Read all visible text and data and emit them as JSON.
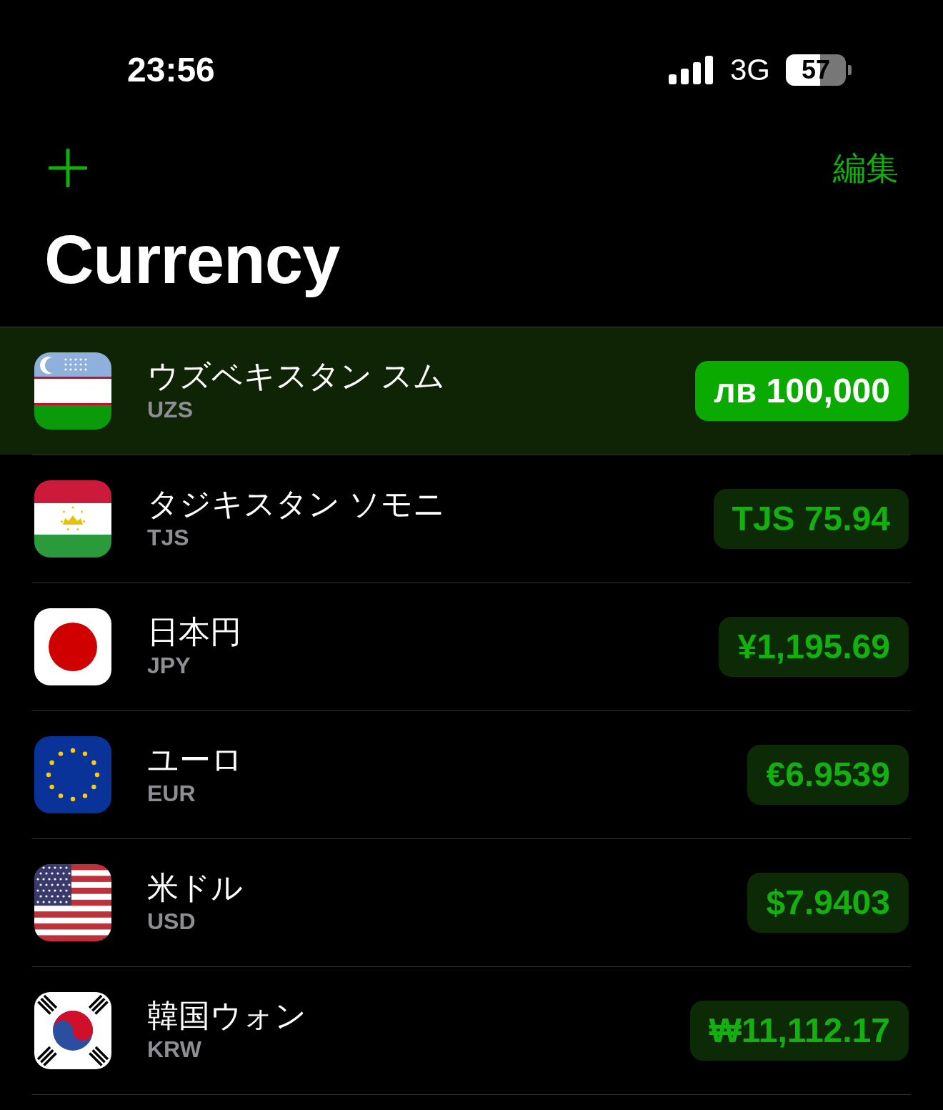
{
  "status_bar": {
    "time": "23:56",
    "network": "3G",
    "battery": "57"
  },
  "nav": {
    "edit": "編集"
  },
  "title": "Currency",
  "currencies": [
    {
      "kind": "uz",
      "name": "ウズベキスタン スム",
      "code": "UZS",
      "amount": "лв 100,000",
      "selected": true
    },
    {
      "kind": "tj",
      "name": "タジキスタン ソモニ",
      "code": "TJS",
      "amount": "TJS 75.94",
      "selected": false
    },
    {
      "kind": "jp",
      "name": "日本円",
      "code": "JPY",
      "amount": "¥1,195.69",
      "selected": false
    },
    {
      "kind": "eu",
      "name": "ユーロ",
      "code": "EUR",
      "amount": "€6.9539",
      "selected": false
    },
    {
      "kind": "us",
      "name": "米ドル",
      "code": "USD",
      "amount": "$7.9403",
      "selected": false
    },
    {
      "kind": "kr",
      "name": "韓国ウォン",
      "code": "KRW",
      "amount": "₩11,112.17",
      "selected": false
    }
  ]
}
